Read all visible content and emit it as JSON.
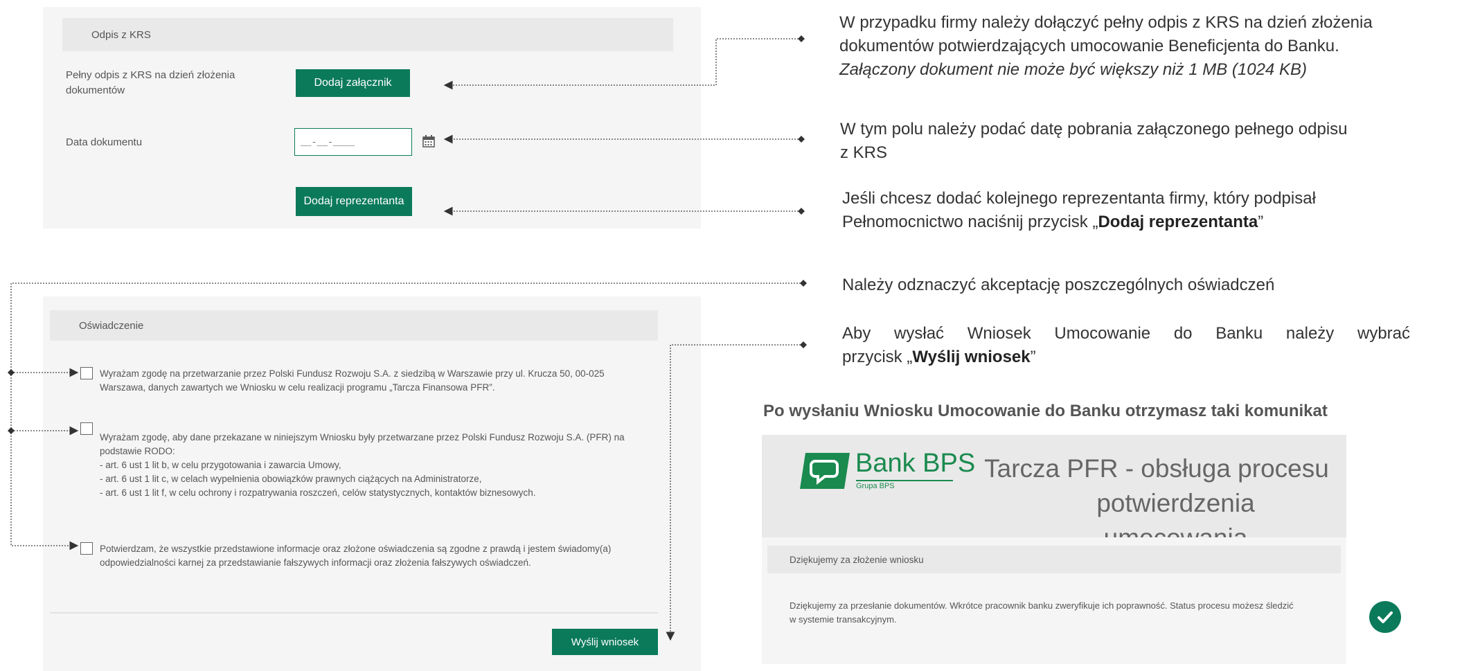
{
  "krs_section": {
    "header": "Odpis z KRS",
    "full_copy_label": "Pełny odpis z KRS na dzień złożenia dokumentów",
    "attach_button": "Dodaj załącznik",
    "date_label": "Data dokumentu",
    "date_field_value": "__-__-____",
    "add_rep_button": "Dodaj reprezentanta"
  },
  "statement_section": {
    "header": "Oświadczenie",
    "statements": [
      "Wyrażam zgodę na przetwarzanie przez Polski Fundusz Rozwoju S.A. z siedzibą w Warszawie przy ul. Krucza 50, 00-025 Warszawa, danych zawartych we Wniosku w celu realizacji programu „Tarcza Finansowa PFR”.",
      "Wyrażam zgodę, aby dane przekazane w niniejszym Wniosku były przetwarzane przez Polski Fundusz Rozwoju S.A. (PFR) na podstawie RODO:",
      "Potwierdzam, że wszystkie przedstawione informacje oraz złożone oświadczenia są zgodne z prawdą i jestem świadomy(a) odpowiedzialności karnej za przedstawianie fałszywych informacji oraz złożenia fałszywych oświadczeń."
    ],
    "rodo_points": [
      "- art. 6 ust 1 lit b, w celu przygotowania i zawarcia Umowy,",
      "- art. 6 ust 1 lit c, w celach wypełnienia obowiązków prawnych ciążących na Administratorze,",
      "- art. 6 ust 1 lit f, w celu ochrony i rozpatrywania roszczeń, celów statystycznych, kontaktów biznesowych."
    ],
    "submit_button": "Wyślij wniosek"
  },
  "annotations": {
    "a1_line1": "W przypadku firmy należy dołączyć pełny odpis z KRS na dzień złożenia",
    "a1_line2": "dokumentów potwierdzających umocowanie Beneficjenta do Banku.",
    "a1_line3": "Załączony dokument nie może być większy niż 1 MB (1024 KB)",
    "a2_line1": "W tym polu należy podać datę pobrania załączonego pełnego odpisu",
    "a2_line2": "z KRS",
    "a3_line1": "Jeśli chcesz dodać kolejnego reprezentanta firmy, który podpisał",
    "a3_prefix": "Pełnomocnictwo naciśnij przycisk „",
    "a3_bold": "Dodaj reprezentanta",
    "a3_suffix": "”",
    "a4": "Należy odznaczyć akceptację poszczególnych oświadczeń",
    "a5_line1": "Aby wysłać Wniosek Umocowanie do Banku należy wybrać",
    "a5_prefix": "przycisk „",
    "a5_bold": "Wyślij wniosek",
    "a5_suffix": "”",
    "heading": "Po wysłaniu Wniosku Umocowanie do Banku otrzymasz taki komunikat"
  },
  "confirmation": {
    "brand_name": "Bank BPS",
    "brand_sub": "Grupa BPS",
    "title_line1": "Tarcza PFR - obsługa procesu",
    "title_line2": "potwierdzenia umocowania",
    "header": "Dziękujemy za złożenie wniosku",
    "message": "Dziękujemy za przesłanie dokumentów. Wkrótce pracownik banku zweryfikuje ich poprawność. Status procesu możesz śledzić w systemie transakcyjnym."
  },
  "colors": {
    "brand_green": "#0b7a5b",
    "panel_bg": "#f5f5f5",
    "header_bg": "#e9e9e9"
  }
}
